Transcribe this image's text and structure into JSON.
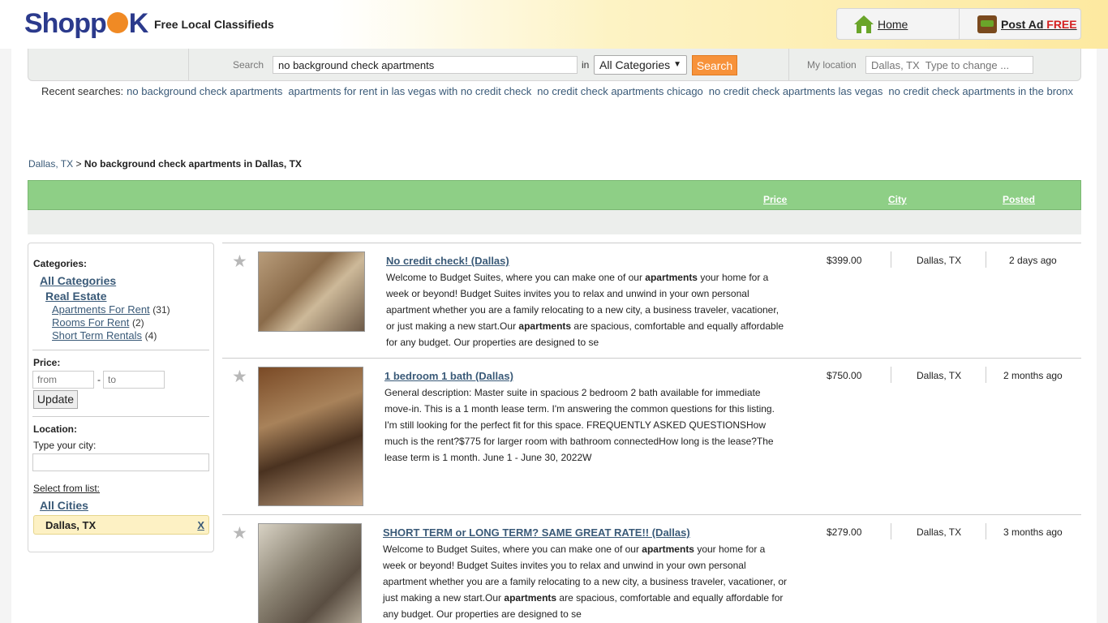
{
  "header": {
    "logo": "Shopp K",
    "logo_left": "Shopp",
    "logo_right": "K",
    "tagline": "Free Local Classifieds",
    "home_label": "Home",
    "post_label": "Post Ad",
    "post_free": "FREE"
  },
  "search": {
    "label": "Search",
    "value": "no background check apartments",
    "in_label": "in",
    "category": "All Categories",
    "button": "Search",
    "location_label": "My location",
    "location_placeholder": "Dallas, TX  Type to change ..."
  },
  "recent": {
    "label": "Recent searches:",
    "items": [
      "no background check apartments",
      "apartments for rent in las vegas with no credit check",
      "no credit check apartments chicago",
      "no credit check apartments las vegas",
      "no credit check apartments in the bronx"
    ]
  },
  "breadcrumb": {
    "link": "Dallas, TX",
    "sep": ">",
    "current": "No background check apartments in Dallas, TX"
  },
  "columns": {
    "price": "Price",
    "city": "City",
    "posted": "Posted"
  },
  "sidebar": {
    "categories_label": "Categories:",
    "all_categories": "All Categories",
    "real_estate": "Real Estate",
    "subcats": [
      {
        "label": "Apartments For Rent",
        "count": "(31)"
      },
      {
        "label": "Rooms For Rent",
        "count": "(2)"
      },
      {
        "label": "Short Term Rentals",
        "count": "(4)"
      }
    ],
    "price_label": "Price:",
    "from_placeholder": "from",
    "dash": "-",
    "to_placeholder": "to",
    "update": "Update",
    "location_label": "Location:",
    "type_city": "Type your city:",
    "select_from_list": "Select from list:",
    "all_cities": "All Cities",
    "selected_city": "Dallas, TX",
    "remove": "X"
  },
  "listings": [
    {
      "title": "No credit check! (Dallas)",
      "desc_1": "Welcome to Budget Suites, where you can make one of our ",
      "desc_b1": "apartments",
      "desc_2": " your home for a week or beyond! Budget Suites invites you to relax and unwind in your own personal apartment whether you are a family relocating to a new city, a business traveler, vacationer, or just making a new start.Our ",
      "desc_b2": "apartments",
      "desc_3": " are spacious, comfortable and equally affordable for any budget. Our properties are designed to se",
      "price": "$399.00",
      "city": "Dallas, TX",
      "posted": "2 days ago"
    },
    {
      "title": "1 bedroom 1 bath (Dallas)",
      "desc_1": "General description: Master suite in spacious 2 bedroom 2 bath available for immediate move-in. This is a 1 month lease term. I'm answering the common questions for this listing. I'm still looking for the perfect fit for this space. FREQUENTLY ASKED QUESTIONSHow much is the rent?$775 for larger room with bathroom connectedHow long is the lease?The lease term is 1 month. June 1 - June 30, 2022W",
      "desc_b1": "",
      "desc_2": "",
      "desc_b2": "",
      "desc_3": "",
      "price": "$750.00",
      "city": "Dallas, TX",
      "posted": "2 months ago"
    },
    {
      "title": "SHORT TERM or LONG TERM? SAME GREAT RATE!! (Dallas)",
      "desc_1": "Welcome to Budget Suites, where you can make one of our ",
      "desc_b1": "apartments",
      "desc_2": " your home for a week or beyond! Budget Suites invites you to relax and unwind in your own personal apartment whether you are a family relocating to a new city, a business traveler, vacationer, or just making a new start.Our ",
      "desc_b2": "apartments",
      "desc_3": " are spacious, comfortable and equally affordable for any budget. Our properties are designed to se",
      "price": "$279.00",
      "city": "Dallas, TX",
      "posted": "3 months ago"
    }
  ],
  "icons": {
    "star": "star-icon",
    "home": "home-icon",
    "bag": "shopping-bag-icon"
  },
  "colors": {
    "accent_orange": "#f7923a",
    "header_green": "#8ecf86",
    "link": "#3a5a78",
    "brand_blue": "#2b3a8c",
    "free_red": "#d42020"
  }
}
